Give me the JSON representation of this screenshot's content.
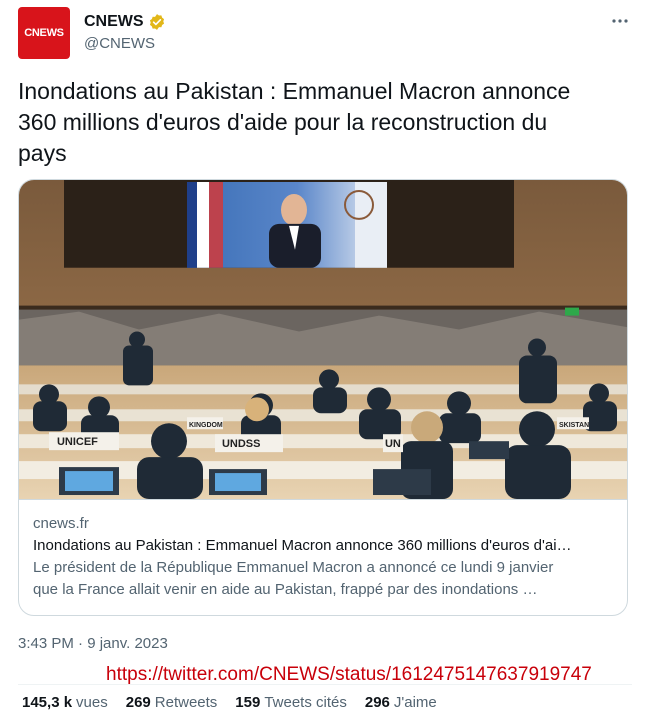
{
  "author": {
    "display_name": "CNEWS",
    "handle": "@CNEWS",
    "avatar_text": "CNEWS",
    "verified_icon": "verified-badge-icon"
  },
  "tweet": {
    "text_line1": "Inondations au Pakistan : Emmanuel Macron annonce",
    "text_line2": "360 millions d'euros d'aide pour la reconstruction du",
    "text_line3": "pays"
  },
  "card": {
    "domain": "cnews.fr",
    "title": "Inondations au Pakistan : Emmanuel Macron annonce 360 millions d'euros d'ai…",
    "desc_line1": "Le président de la République Emmanuel Macron a annoncé ce lundi 9 janvier",
    "desc_line2": "que la France allait venir en aide au Pakistan, frappé par des inondations …",
    "image_signs": [
      "UNICEF",
      "UNDSS",
      "KINGDOM",
      "UN",
      "SKISTAN"
    ]
  },
  "timestamp": "3:43 PM · 9 janv. 2023",
  "source_url": "https://twitter.com/CNEWS/status/1612475147637919747",
  "stats": [
    {
      "count": "145,3 k",
      "label": "vues"
    },
    {
      "count": "269",
      "label": "Retweets"
    },
    {
      "count": "159",
      "label": "Tweets cités"
    },
    {
      "count": "296",
      "label": "J'aime"
    }
  ],
  "colors": {
    "brand_red": "#d8141b",
    "verified_gold": "#e2b719",
    "url_red": "#c8000a",
    "secondary_text": "#536471"
  }
}
